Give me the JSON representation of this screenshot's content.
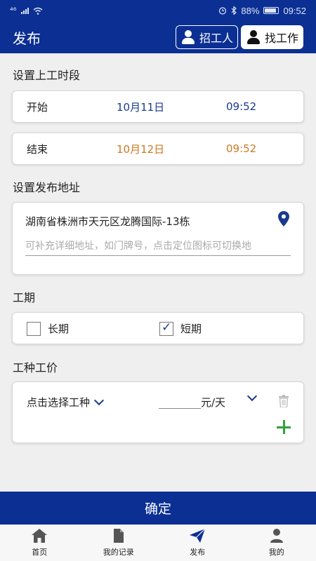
{
  "status_bar": {
    "left": "⁴⁶",
    "battery": "88%",
    "time": "09:52"
  },
  "header": {
    "title": "发布",
    "recruit_label": "招工人",
    "find_job_label": "找工作"
  },
  "schedule": {
    "section_title": "设置上工时段",
    "start": {
      "label": "开始",
      "date": "10月11日",
      "time": "09:52"
    },
    "end": {
      "label": "结束",
      "date": "10月12日",
      "time": "09:52"
    }
  },
  "address": {
    "section_title": "设置发布地址",
    "value": "湖南省株洲市天元区龙腾国际-13栋",
    "detail_placeholder": "可补充详细地址，如门牌号，点击定位图标可切换地"
  },
  "period": {
    "section_title": "工期",
    "long_label": "长期",
    "short_label": "短期",
    "selected": "短期"
  },
  "trade": {
    "section_title": "工种工价",
    "select_label": "点击选择工种",
    "unit": "元/天"
  },
  "confirm_label": "确定",
  "nav": [
    {
      "label": "首页",
      "icon": "home-icon"
    },
    {
      "label": "我的记录",
      "icon": "document-icon"
    },
    {
      "label": "发布",
      "icon": "send-icon",
      "active": true
    },
    {
      "label": "我的",
      "icon": "user-icon"
    }
  ],
  "colors": {
    "primary": "#0b2f93",
    "date_blue": "#1a3a8c",
    "date_orange": "#cc7a22",
    "add_green": "#2fa33a"
  }
}
